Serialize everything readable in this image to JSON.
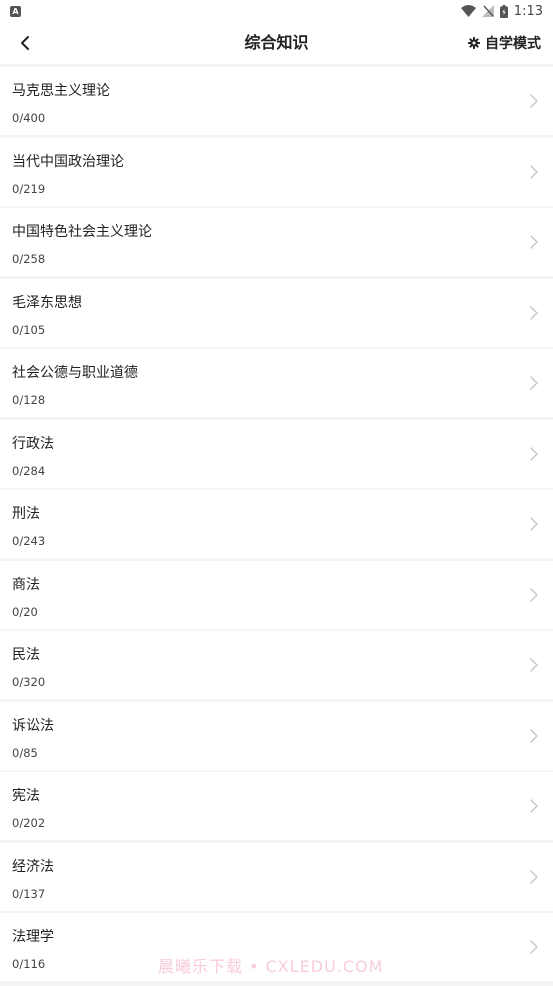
{
  "status_bar": {
    "app_badge": "A",
    "time": "1:13"
  },
  "header": {
    "title": "综合知识",
    "mode_label": "自学模式"
  },
  "items": [
    {
      "title": "马克思主义理论",
      "count": "0/400"
    },
    {
      "title": "当代中国政治理论",
      "count": "0/219"
    },
    {
      "title": "中国特色社会主义理论",
      "count": "0/258"
    },
    {
      "title": "毛泽东思想",
      "count": "0/105"
    },
    {
      "title": "社会公德与职业道德",
      "count": "0/128"
    },
    {
      "title": "行政法",
      "count": "0/284"
    },
    {
      "title": "刑法",
      "count": "0/243"
    },
    {
      "title": "商法",
      "count": "0/20"
    },
    {
      "title": "民法",
      "count": "0/320"
    },
    {
      "title": "诉讼法",
      "count": "0/85"
    },
    {
      "title": "宪法",
      "count": "0/202"
    },
    {
      "title": "经济法",
      "count": "0/137"
    },
    {
      "title": "法理学",
      "count": "0/116"
    }
  ],
  "watermark": "晨曦乐下载 • CXLEDU.COM",
  "colors": {
    "background": "#f5f5f7",
    "card": "#ffffff",
    "text": "#222222",
    "chevron": "#c8c8c8"
  }
}
